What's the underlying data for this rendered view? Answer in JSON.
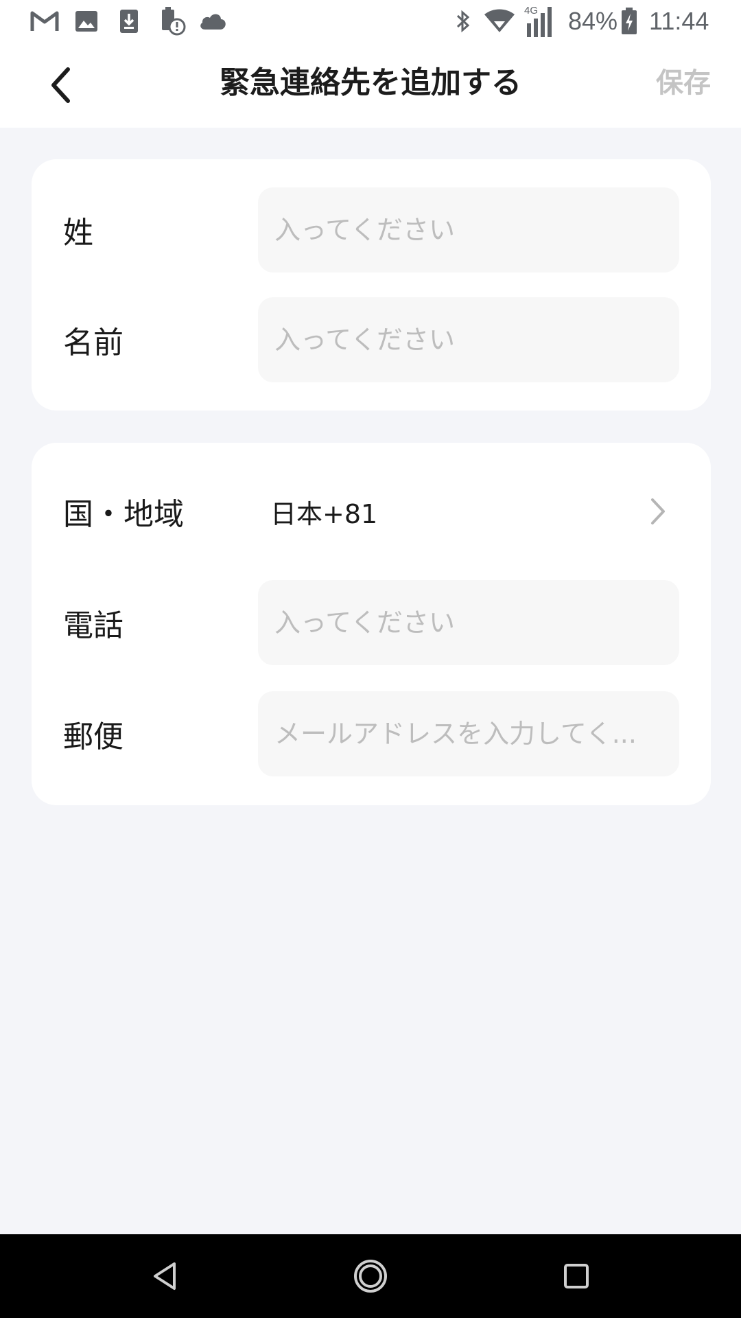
{
  "status_bar": {
    "network": "4G",
    "battery": "84%",
    "time": "11:44",
    "left_icons": [
      "gmail-icon",
      "gallery-icon",
      "download-icon",
      "battery-alert-icon",
      "cloud-icon"
    ],
    "right_icons": [
      "bluetooth-icon",
      "wifi-icon",
      "signal-icon",
      "battery-charging-icon"
    ]
  },
  "header": {
    "title": "緊急連絡先を追加する",
    "save_label": "保存",
    "back_icon": "chevron-left-icon"
  },
  "form": {
    "last_name": {
      "label": "姓",
      "value": "",
      "placeholder": "入ってください"
    },
    "first_name": {
      "label": "名前",
      "value": "",
      "placeholder": "入ってください"
    },
    "region": {
      "label": "国・地域",
      "value": "日本+81",
      "icon": "chevron-right-icon"
    },
    "phone": {
      "label": "電話",
      "value": "",
      "placeholder": "入ってください"
    },
    "email": {
      "label": "郵便",
      "value": "",
      "placeholder": "メールアドレスを入力してく..."
    }
  },
  "nav_bar": {
    "icons": [
      "nav-back-icon",
      "nav-home-icon",
      "nav-recents-icon"
    ]
  },
  "colors": {
    "page_background": "#f4f5f9",
    "card_background": "#ffffff",
    "input_background": "#f7f7f7",
    "placeholder_text": "#bdbdbd",
    "save_disabled": "#c4c4c4",
    "nav_bar": "#000000"
  }
}
